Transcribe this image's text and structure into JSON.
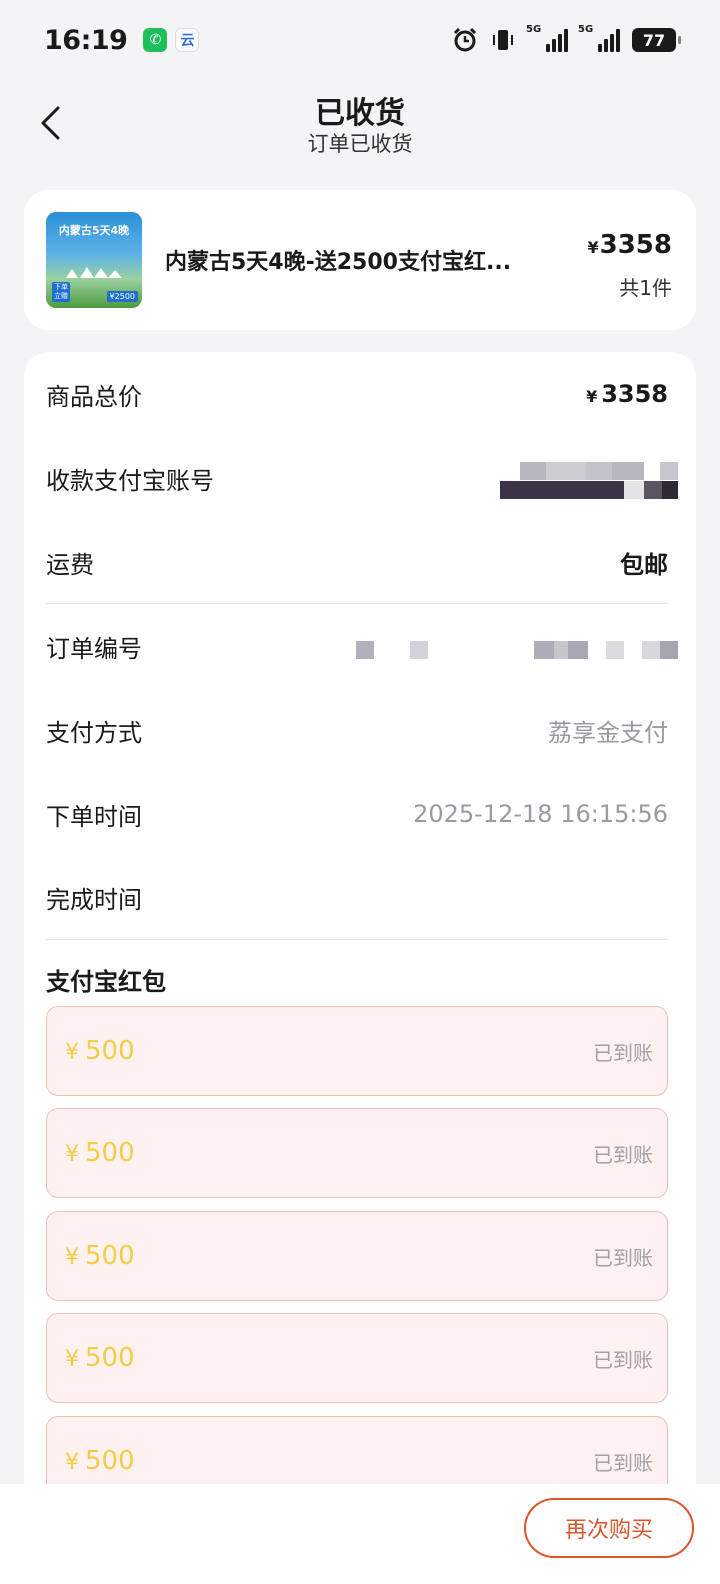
{
  "status_bar": {
    "time": "16:19",
    "apps": [
      {
        "icon": "wechat-icon",
        "glyph": "✆"
      },
      {
        "icon": "cloud-app-icon",
        "glyph": "云"
      }
    ],
    "signal_1_label": "5G",
    "signal_2_label": "5G",
    "battery": "77"
  },
  "header": {
    "title": "已收货",
    "subtitle": "订单已收货"
  },
  "product": {
    "thumb_title": "内蒙古5天4晚",
    "thumb_tag": "下单\n立赠",
    "thumb_price": "¥2500",
    "name": "内蒙古5天4晚-送2500支付宝红...",
    "yen": "¥",
    "price": "3358",
    "qty": "共1件"
  },
  "details": {
    "total_label": "商品总价",
    "total_yen": "¥",
    "total_value": "3358",
    "account_label": "收款支付宝账号",
    "shipping_label": "运费",
    "shipping_value": "包邮",
    "order_no_label": "订单编号",
    "pay_method_label": "支付方式",
    "pay_method_value": "荔享金支付",
    "order_time_label": "下单时间",
    "order_time_value": "2025-12-18 16:15:56",
    "finish_time_label": "完成时间",
    "finish_time_value": ""
  },
  "redpackets": {
    "title": "支付宝红包",
    "items": [
      {
        "yen": "¥",
        "amount": "500",
        "status": "已到账"
      },
      {
        "yen": "¥",
        "amount": "500",
        "status": "已到账"
      },
      {
        "yen": "¥",
        "amount": "500",
        "status": "已到账"
      },
      {
        "yen": "¥",
        "amount": "500",
        "status": "已到账"
      },
      {
        "yen": "¥",
        "amount": "500",
        "status": "已到账"
      }
    ]
  },
  "bottom": {
    "buy_again": "再次购买"
  },
  "colors": {
    "accent": "#d9572e",
    "redpacket_bg": "#fff1ef",
    "redpacket_amount": "#f2cd4a"
  }
}
